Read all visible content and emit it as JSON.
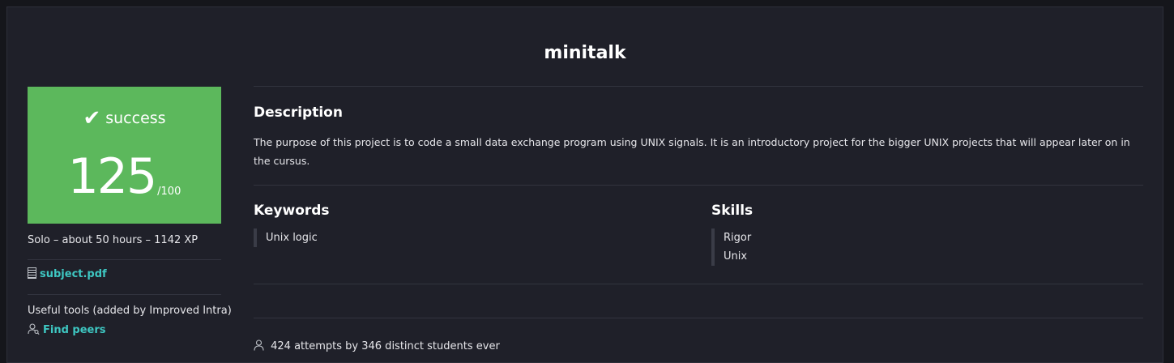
{
  "project": {
    "title": "minitalk"
  },
  "result": {
    "status": "success",
    "grade": "125",
    "grade_max": "/100",
    "color": "#5cb85c"
  },
  "info": {
    "meta": "Solo – about 50 hours – 1142 XP",
    "subject_link": "subject.pdf",
    "tools_label": "Useful tools (added by Improved Intra)",
    "find_peers": "Find peers"
  },
  "description": {
    "heading": "Description",
    "text": "The purpose of this project is to code a small data exchange program using UNIX signals. It is an introductory project for the bigger UNIX projects that will appear later on in the cursus."
  },
  "keywords": {
    "heading": "Keywords",
    "items": [
      "Unix logic"
    ]
  },
  "skills": {
    "heading": "Skills",
    "items": [
      "Rigor",
      "Unix"
    ]
  },
  "stats": {
    "attempts": "424 attempts by 346 distinct students ever"
  },
  "icons": {
    "status": "check-icon",
    "subject": "pdf-icon",
    "peers": "person-search-icon",
    "attempts": "person-icon"
  },
  "colors": {
    "accent": "#3ec7c2",
    "background": "#1f2029"
  }
}
